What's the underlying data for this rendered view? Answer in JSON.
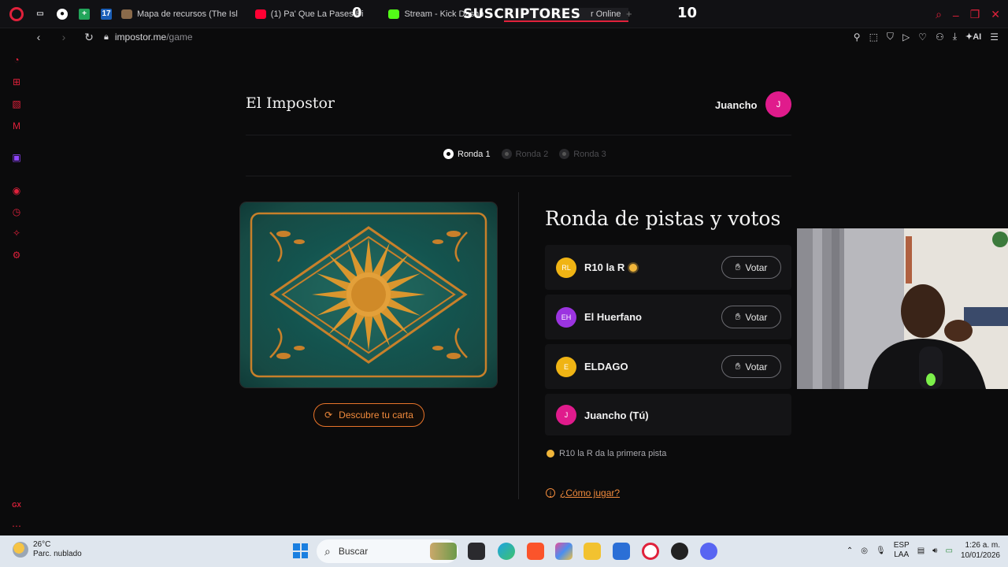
{
  "browser": {
    "tabs": [
      {
        "label": "Mapa de recursos (The Isl",
        "color": "#8a6a4a"
      },
      {
        "label": "(1) Pa' Que La Pases Bi",
        "color": "#ff0033"
      },
      {
        "label": "Stream - Kick Dashb",
        "color": "#53fc18"
      },
      {
        "label": "r Online",
        "color": "#e0213b"
      }
    ],
    "new_tab": "+",
    "url_host": "impostor.me",
    "url_path": "/game",
    "ai_label": "AI"
  },
  "stream_overlay": {
    "count_left": "0",
    "title": "SUSCRIPTORES",
    "count_right": "10"
  },
  "site": {
    "title": "El Impostor",
    "user_name": "Juancho",
    "user_initial": "J"
  },
  "rounds": [
    {
      "label": "Ronda 1",
      "active": true
    },
    {
      "label": "Ronda 2",
      "active": false
    },
    {
      "label": "Ronda 3",
      "active": false
    }
  ],
  "card": {
    "discover_label": "Descubre tu carta"
  },
  "panel": {
    "title": "Ronda de pistas y votos",
    "players": [
      {
        "initials": "RL",
        "name": "R10 la R",
        "color": "#f0b414",
        "has_sun": true,
        "vote": "Votar"
      },
      {
        "initials": "EH",
        "name": "El Huerfano",
        "color": "#9b34e0",
        "has_sun": false,
        "vote": "Votar"
      },
      {
        "initials": "E",
        "name": "ELDAGO",
        "color": "#f0b414",
        "has_sun": false,
        "vote": "Votar"
      },
      {
        "initials": "J",
        "name": "Juancho (Tú)",
        "color": "#e01b8c",
        "has_sun": false,
        "vote": ""
      }
    ],
    "clue_text": "R10 la R da la primera pista",
    "howto": "¿Cómo jugar?"
  },
  "taskbar": {
    "temperature": "26°C",
    "weather_desc": "Parc. nublado",
    "search_placeholder": "Buscar",
    "lang_top": "ESP",
    "lang_bottom": "LAA",
    "time": "1:26 a. m.",
    "date": "10/01/2026"
  }
}
